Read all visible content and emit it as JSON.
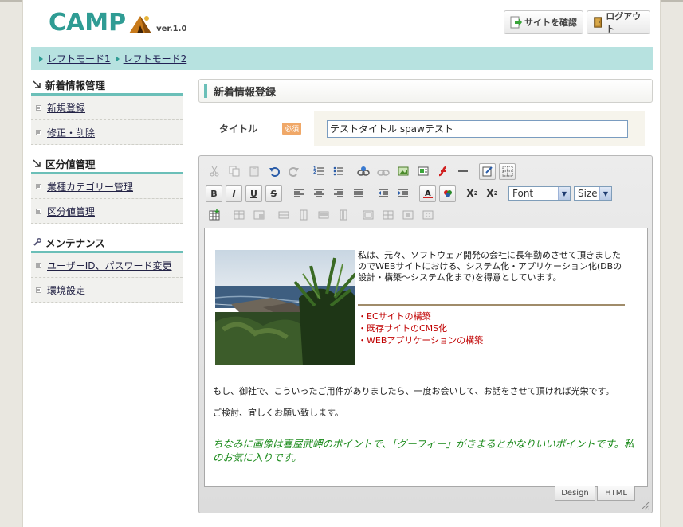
{
  "header": {
    "logo_text": "CAMP",
    "logo_version": "ver.1.0",
    "view_site_label": "サイトを確認",
    "logout_label": "ログアウト"
  },
  "breadcrumb": [
    "レフトモード1",
    "レフトモード2"
  ],
  "sidebar": {
    "sections": [
      {
        "title": "新着情報管理",
        "icon": "arrow-icon",
        "items": [
          "新規登録",
          "修正・削除"
        ]
      },
      {
        "title": "区分値管理",
        "icon": "arrow-icon",
        "items": [
          "業種カテゴリー管理",
          "区分値管理"
        ]
      },
      {
        "title": "メンテナンス",
        "icon": "wrench-icon",
        "items": [
          "ユーザーID、パスワード変更",
          "環境設定"
        ]
      }
    ]
  },
  "main": {
    "title": "新着情報登録",
    "form": {
      "title_label": "タイトル",
      "required_badge": "必須",
      "title_value": "テストタイトル spawテスト"
    }
  },
  "editor": {
    "font_select": "Font",
    "size_select": "Size",
    "content": {
      "intro": "私は、元々、ソフトウェア開発の会社に長年勤めさせて頂きましたのでWEBサイトにおける、システム化・アプリケーション化(DBの設計・構築～システム化まで)を得意としています。",
      "list": [
        "・ECサイトの構築",
        "・既存サイトのCMS化",
        "・WEBアプリケーションの構築"
      ],
      "para1": "もし、御社で、こういったご用件がありましたら、一度お会いして、お話をさせて頂ければ光栄です。",
      "para2": "ご検討、宜しくお願い致します。",
      "note": "ちなみに画像は喜屋武岬のポイントで、「グーフィー」がきまるとかなりいいポイントです。私のお気に入りです。"
    },
    "tabs": {
      "design": "Design",
      "html": "HTML"
    }
  },
  "colors": {
    "accent": "#6bbfb8",
    "breadcrumb_bg": "#b7e2e0",
    "list_text": "#c00000",
    "note_text": "#1a8a1a"
  }
}
